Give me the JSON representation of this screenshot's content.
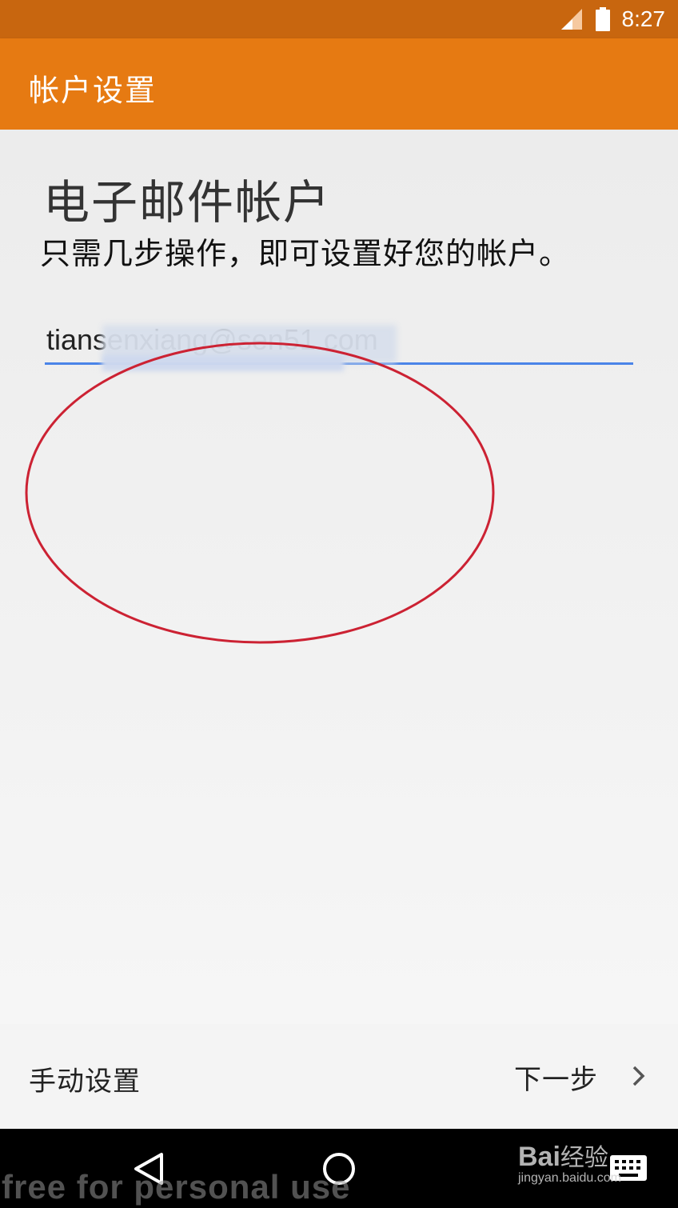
{
  "status_bar": {
    "time": "8:27",
    "signal_icon": "signal-icon",
    "battery_icon": "battery-icon"
  },
  "app_bar": {
    "title": "帐户设置"
  },
  "main": {
    "heading": "电子邮件帐户",
    "subheading": "只需几步操作，即可设置好您的帐户。",
    "email_value": "tiansenxiang@sen51.com",
    "annotation_color": "#cc2233"
  },
  "footer": {
    "manual_label": "手动设置",
    "next_label": "下一步",
    "next_icon": "chevron-right-icon"
  },
  "nav": {
    "back_icon": "back-triangle-icon",
    "home_icon": "home-circle-icon",
    "keyboard_icon": "keyboard-icon"
  },
  "watermark": {
    "left_text": "free for personal use",
    "brand": "Bai",
    "brand_suffix": "经验",
    "url": "jingyan.baidu.com"
  },
  "colors": {
    "accent": "#e67a12",
    "status": "#c8660f",
    "field_underline": "#4a84e8"
  }
}
